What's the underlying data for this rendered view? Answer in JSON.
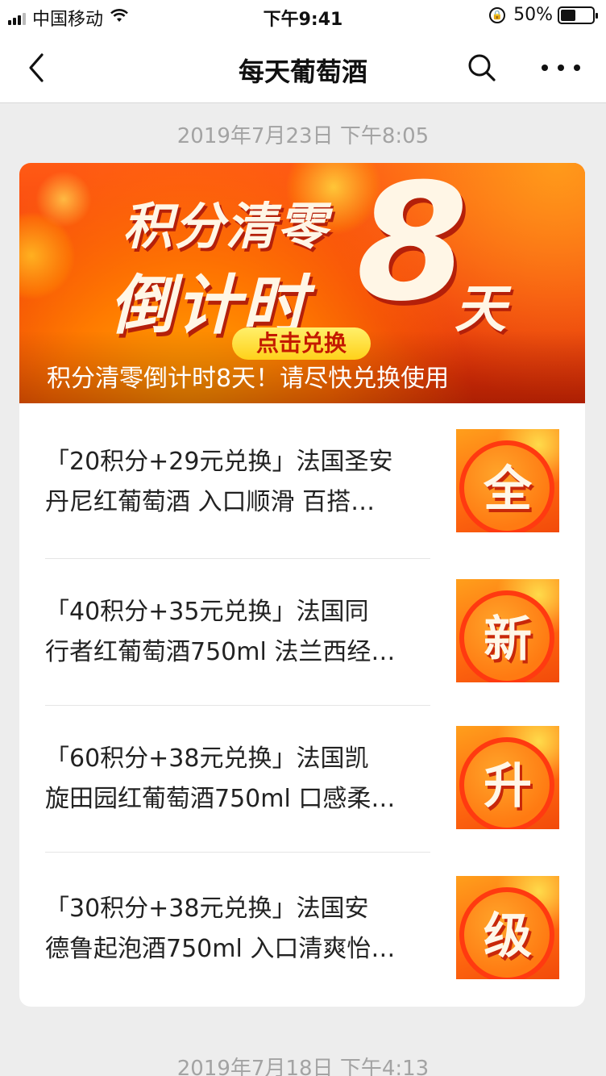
{
  "status_bar": {
    "carrier": "中国移动",
    "time": "下午9:41",
    "battery": "50%",
    "battery_level": 0.5
  },
  "nav": {
    "title": "每天葡萄酒",
    "back_icon": "chevron-left-icon",
    "search_icon": "search-icon",
    "more_icon": "more-dots-icon"
  },
  "timestamps": [
    "2019年7月23日 下午8:05",
    "2019年7月18日 下午4:13"
  ],
  "banner": {
    "headline_line1": "积分清零",
    "headline_line2": "倒计时",
    "number": "8",
    "day": "天",
    "button": "点击兑换",
    "caption": "积分清零倒计时8天！请尽快兑换使用"
  },
  "articles": [
    {
      "line1": "「20积分+29元兑换」法国圣安",
      "line2": "丹尼红葡萄酒 入口顺滑 百搭…",
      "thumb": "全"
    },
    {
      "line1": "「40积分+35元兑换」法国同",
      "line2": "行者红葡萄酒750ml 法兰西经…",
      "thumb": "新"
    },
    {
      "line1": "「60积分+38元兑换」法国凯",
      "line2": "旋田园红葡萄酒750ml 口感柔…",
      "thumb": "升"
    },
    {
      "line1": "「30积分+38元兑换」法国安",
      "line2": "德鲁起泡酒750ml 入口清爽怡…",
      "thumb": "级"
    }
  ],
  "colors": {
    "banner_red": "#f23b0c",
    "banner_orange": "#ff7a00",
    "pill_yellow": "#ffd11a",
    "page_bg": "#ededed"
  }
}
